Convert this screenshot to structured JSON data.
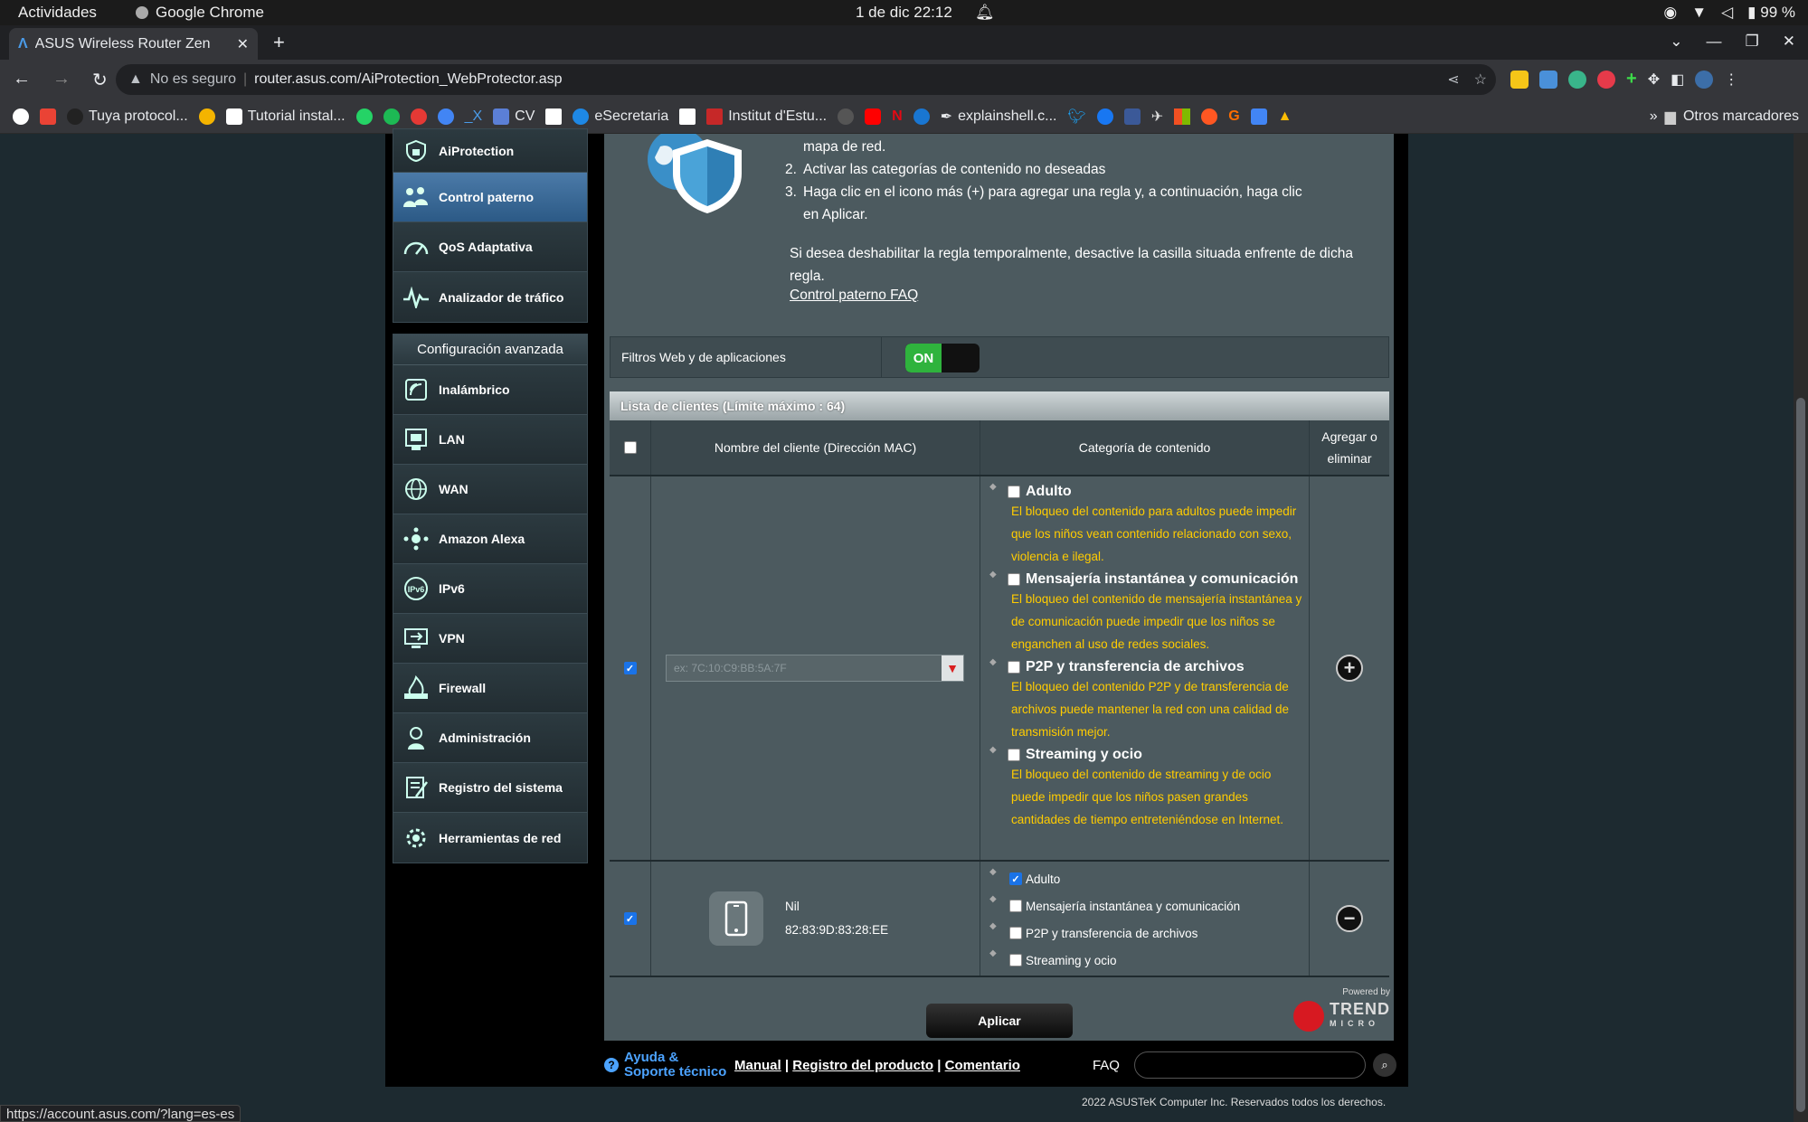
{
  "os": {
    "activities": "Actividades",
    "app_name": "Google Chrome",
    "clock": "1 de dic  22:12",
    "battery": "99 %"
  },
  "browser": {
    "tab_title": "ASUS Wireless Router Zen",
    "security": "No es seguro",
    "url": "router.asus.com/AiProtection_WebProtector.asp",
    "bookmarks": [
      "Tuya protocol...",
      "Tutorial instal...",
      "CV",
      "eSecretaria",
      "Institut d'Estu...",
      "explainshell.c..."
    ],
    "other_bookmarks": "Otros marcadores",
    "more": "»"
  },
  "sidebar": {
    "top_items": [
      {
        "label": "AiProtection"
      },
      {
        "label": "Control paterno"
      },
      {
        "label": "QoS Adaptativa"
      },
      {
        "label": "Analizador de tráfico"
      }
    ],
    "advanced_header": "Configuración avanzada",
    "advanced_items": [
      {
        "label": "Inalámbrico"
      },
      {
        "label": "LAN"
      },
      {
        "label": "WAN"
      },
      {
        "label": "Amazon Alexa"
      },
      {
        "label": "IPv6"
      },
      {
        "label": "VPN"
      },
      {
        "label": "Firewall"
      },
      {
        "label": "Administración"
      },
      {
        "label": "Registro del sistema"
      },
      {
        "label": "Herramientas de red"
      }
    ]
  },
  "content": {
    "step1_tail": "mapa de red.",
    "step2": "Activar las categorías de contenido no deseadas",
    "step3_a": "Haga clic en el icono más (+) para agregar una regla y, a continuación, haga clic",
    "step3_b": "en Aplicar.",
    "disable_note": "Si desea deshabilitar la regla temporalmente, desactive la casilla situada enfrente de dicha regla.",
    "faq_link": "Control paterno FAQ",
    "filter_label": "Filtros Web y de aplicaciones",
    "toggle_on": "ON",
    "client_list_header": "Lista de clientes (Límite máximo : 64)",
    "col_name": "Nombre del cliente (Dirección MAC)",
    "col_category": "Categoría de contenido",
    "col_action": "Agregar o eliminar",
    "new_rule_placeholder": "ex: 7C:10:C9:BB:5A:7F",
    "categories": [
      {
        "title": "Adulto",
        "desc": "El bloqueo del contenido para adultos puede impedir que los niños vean contenido relacionado con sexo, violencia e ilegal."
      },
      {
        "title": "Mensajería instantánea y comunicación",
        "desc": "El bloqueo del contenido de mensajería instantánea y de comunicación puede impedir que los niños se enganchen al uso de redes sociales."
      },
      {
        "title": "P2P y transferencia de archivos",
        "desc": "El bloqueo del contenido P2P y de transferencia de archivos puede mantener la red con una calidad de transmisión mejor."
      },
      {
        "title": "Streaming y ocio",
        "desc": "El bloqueo del contenido de streaming y de ocio puede impedir que los niños pasen grandes cantidades de tiempo entreteniéndose en Internet."
      }
    ],
    "rule": {
      "name": "Nil",
      "mac": "82:83:9D:83:28:EE",
      "categories": [
        {
          "label": "Adulto",
          "checked": true
        },
        {
          "label": "Mensajería instantánea y comunicación",
          "checked": false
        },
        {
          "label": "P2P y transferencia de archivos",
          "checked": false
        },
        {
          "label": "Streaming y ocio",
          "checked": false
        }
      ]
    },
    "powered_by": "Powered by",
    "trend": "TREND",
    "micro": "MICRO",
    "apply": "Aplicar"
  },
  "footer": {
    "help": "Ayuda & Soporte técnico",
    "manual": "Manual",
    "registro": "Registro del producto",
    "comentario": "Comentario",
    "faq": "FAQ",
    "copyright": "2022 ASUSTeK Computer Inc. Reservados todos los derechos."
  },
  "status_url": "https://account.asus.com/?lang=es-es"
}
